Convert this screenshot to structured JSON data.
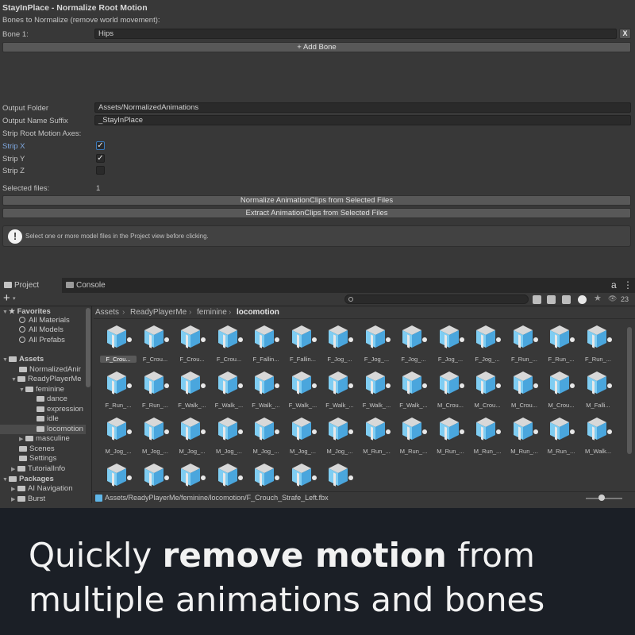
{
  "tool": {
    "title": "StayInPlace - Normalize Root Motion",
    "bones_label": "Bones to Normalize (remove world movement):",
    "bone1_label": "Bone 1:",
    "bone1_value": "Hips",
    "remove_btn": "X",
    "add_bone": "+ Add Bone",
    "output_folder_label": "Output Folder",
    "output_folder_value": "Assets/NormalizedAnimations",
    "suffix_label": "Output Name Suffix",
    "suffix_value": "_StayInPlace",
    "strip_axes_label": "Strip Root Motion Axes:",
    "strip_x_label": "Strip X",
    "strip_x": true,
    "strip_y_label": "Strip Y",
    "strip_y": true,
    "strip_z_label": "Strip Z",
    "strip_z": false,
    "selected_label": "Selected files:",
    "selected_count": "1",
    "normalize_btn": "Normalize AnimationClips from Selected Files",
    "extract_btn": "Extract AnimationClips from Selected Files",
    "help_icon": "!",
    "help_text": "Select one or more model files in the Project view before clicking."
  },
  "tabs": [
    {
      "label": "Project",
      "icon": "folder-icon"
    },
    {
      "label": "Console",
      "icon": "console-icon"
    }
  ],
  "toolbar": {
    "plus": "+",
    "hidden_count": "23"
  },
  "sidebar": {
    "favorites": "Favorites",
    "fav_items": [
      "All Materials",
      "All Models",
      "All Prefabs"
    ],
    "assets": "Assets",
    "asset_items": [
      "NormalizedAnir",
      "ReadyPlayerMe",
      "feminine",
      "dance",
      "expression",
      "idle",
      "locomotion",
      "masculine",
      "Scenes",
      "Settings",
      "TutorialInfo"
    ],
    "packages": "Packages",
    "package_items": [
      "AI Navigation",
      "Burst"
    ]
  },
  "breadcrumb": [
    "Assets",
    "ReadyPlayerMe",
    "feminine",
    "locomotion"
  ],
  "assets": [
    "F_Crou...",
    "F_Crou...",
    "F_Crou...",
    "F_Crou...",
    "F_Fallin...",
    "F_Fallin...",
    "F_Jog_...",
    "F_Jog_...",
    "F_Jog_...",
    "F_Jog_...",
    "F_Jog_...",
    "F_Run_...",
    "F_Run_...",
    "F_Run_...",
    "F_Run_...",
    "F_Run_...",
    "F_Walk_...",
    "F_Walk_...",
    "F_Walk_...",
    "F_Walk_...",
    "F_Walk_...",
    "F_Walk_...",
    "F_Walk_...",
    "M_Crou...",
    "M_Crou...",
    "M_Crou...",
    "M_Crou...",
    "M_Falli...",
    "M_Jog_...",
    "M_Jog_...",
    "M_Jog_...",
    "M_Jog_...",
    "M_Jog_...",
    "M_Jog_...",
    "M_Jog_...",
    "M_Run_...",
    "M_Run_...",
    "M_Run_...",
    "M_Run_...",
    "M_Run_...",
    "M_Run_...",
    "M_Walk...",
    "",
    "",
    "",
    "",
    "",
    "",
    ""
  ],
  "selected_asset_index": 0,
  "status_path": "Assets/ReadyPlayerMe/feminine/locomotion/F_Crouch_Strafe_Left.fbx",
  "caption": {
    "part1": "Quickly ",
    "bold": "remove motion",
    "part2": " from multiple animations and bones"
  },
  "colors": {
    "accent": "#3a79bb",
    "asset_blue": "#5fb6e8",
    "background": "#1b1f26"
  }
}
